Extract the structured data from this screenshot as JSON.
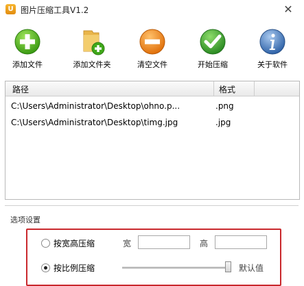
{
  "window": {
    "title": "图片压缩工具V1.2",
    "logo_glyph": "U",
    "close_glyph": "✕"
  },
  "toolbar": {
    "buttons": [
      {
        "label": "添加文件",
        "icon": "add-icon",
        "color": "#4cb81c"
      },
      {
        "label": "添加文件夹",
        "icon": "folder-add-icon",
        "color": "#e9b54a"
      },
      {
        "label": "清空文件",
        "icon": "minus-icon",
        "color": "#f08a12"
      },
      {
        "label": "开始压缩",
        "icon": "check-icon",
        "color": "#3aa438"
      },
      {
        "label": "关于软件",
        "icon": "info-icon",
        "color": "#3b74b8"
      }
    ]
  },
  "file_list": {
    "columns": [
      "路径",
      "格式"
    ],
    "rows": [
      {
        "path": "C:\\Users\\Administrator\\Desktop\\ohno.p...",
        "format": ".png"
      },
      {
        "path": "C:\\Users\\Administrator\\Desktop\\timg.jpg",
        "format": ".jpg"
      }
    ]
  },
  "options": {
    "group_title": "选项设置",
    "by_size": {
      "label": "按宽高压缩",
      "checked": false,
      "width_label": "宽",
      "height_label": "高",
      "width_value": "",
      "height_value": ""
    },
    "by_ratio": {
      "label": "按比例压缩",
      "checked": true,
      "default_label": "默认值"
    }
  }
}
